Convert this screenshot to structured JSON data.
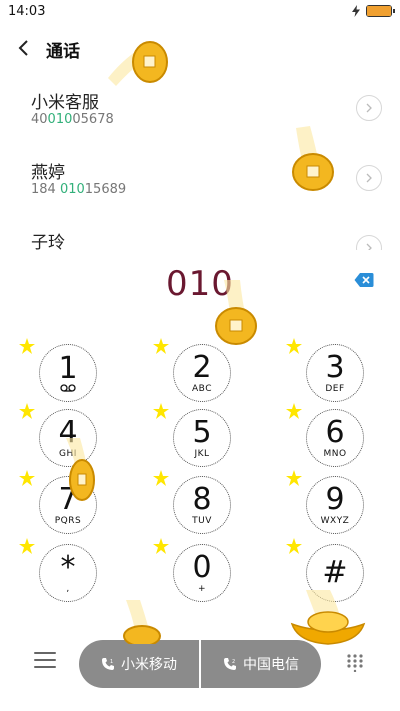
{
  "status_bar": {
    "time": "14:03",
    "battery_level": 1.0
  },
  "header": {
    "title": "通话",
    "back_icon": "chevron-left-icon"
  },
  "contacts": [
    {
      "name": "小米客服",
      "number_pre": "40",
      "number_match": "010",
      "number_post": "05678"
    },
    {
      "name": "燕婷",
      "number_pre": "184 ",
      "number_match": "010",
      "number_post": "15689"
    },
    {
      "name": "子玲"
    }
  ],
  "dialer": {
    "number": "010",
    "delete_icon": "backspace-icon"
  },
  "keypad": [
    {
      "digit": "1",
      "letters": "",
      "sub_icon": "voicemail-icon"
    },
    {
      "digit": "2",
      "letters": "ABC"
    },
    {
      "digit": "3",
      "letters": "DEF"
    },
    {
      "digit": "4",
      "letters": "GHI"
    },
    {
      "digit": "5",
      "letters": "JKL"
    },
    {
      "digit": "6",
      "letters": "MNO"
    },
    {
      "digit": "7",
      "letters": "PQRS"
    },
    {
      "digit": "8",
      "letters": "TUV"
    },
    {
      "digit": "9",
      "letters": "WXYZ"
    },
    {
      "digit": "*",
      "letters": ","
    },
    {
      "digit": "0",
      "letters": "+"
    },
    {
      "digit": "#",
      "letters": ""
    }
  ],
  "bottom_bar": {
    "menu_icon": "menu-icon",
    "call_sim1_label": "小米移动",
    "call_sim2_label": "中国电信",
    "keypad_toggle_icon": "dialpad-icon"
  },
  "colors": {
    "accent": "#32b07a",
    "dialed_number": "#6a1830",
    "call_button": "#8b8b8b",
    "coin": "#f3b720"
  }
}
